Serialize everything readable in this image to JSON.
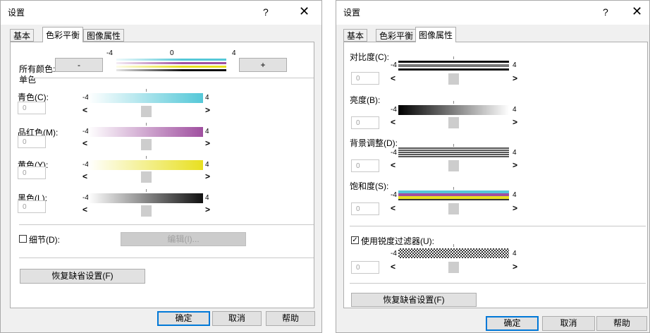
{
  "left": {
    "title": "设置",
    "help": "?",
    "close": "✕",
    "tabs": [
      "基本",
      "色彩平衡",
      "图像属性"
    ],
    "scale_min": "-4",
    "scale_mid": "0",
    "scale_max": "4",
    "all_colors_label": "所有颜色:",
    "minus_label": "-",
    "plus_label": "+",
    "single_color_label": "单色",
    "sliders": [
      {
        "label": "青色(C):",
        "value": "0",
        "min": "-4",
        "max": "4",
        "left": "<",
        "right": ">"
      },
      {
        "label": "品红色(M):",
        "value": "0",
        "min": "-4",
        "max": "4",
        "left": "<",
        "right": ">"
      },
      {
        "label": "黄色(Y):",
        "value": "0",
        "min": "-4",
        "max": "4",
        "left": "<",
        "right": ">"
      },
      {
        "label": "黑色(L):",
        "value": "0",
        "min": "-4",
        "max": "4",
        "left": "<",
        "right": ">"
      }
    ],
    "detail_label": "细节(D):",
    "edit_label": "编辑(I)...",
    "restore_label": "恢复缺省设置(F)",
    "ok": "确定",
    "cancel": "取消",
    "helpbtn": "帮助",
    "colors": {
      "cyan": "#55c8d8",
      "magenta": "#a050a0",
      "yellow": "#e8e020",
      "black": "#111111"
    }
  },
  "right": {
    "title": "设置",
    "help": "?",
    "close": "✕",
    "tabs": [
      "基本",
      "色彩平衡",
      "图像属性"
    ],
    "sliders": [
      {
        "label": "对比度(C):",
        "value": "0",
        "min": "-4",
        "max": "4",
        "left": "<",
        "right": ">"
      },
      {
        "label": "亮度(B):",
        "value": "0",
        "min": "-4",
        "max": "4",
        "left": "<",
        "right": ">"
      },
      {
        "label": "背景调整(D):",
        "value": "0",
        "min": "-4",
        "max": "4",
        "left": "<",
        "right": ">"
      },
      {
        "label": "饱和度(S):",
        "value": "0",
        "min": "-4",
        "max": "4",
        "left": "<",
        "right": ">"
      }
    ],
    "sharp_label": "使用锐度过滤器(U):",
    "sharp_checked": "✓",
    "sharp_slider": {
      "value": "0",
      "min": "-4",
      "max": "4",
      "left": "<",
      "right": ">"
    },
    "restore_label": "恢复缺省设置(F)",
    "ok": "确定",
    "cancel": "取消",
    "helpbtn": "帮助"
  }
}
